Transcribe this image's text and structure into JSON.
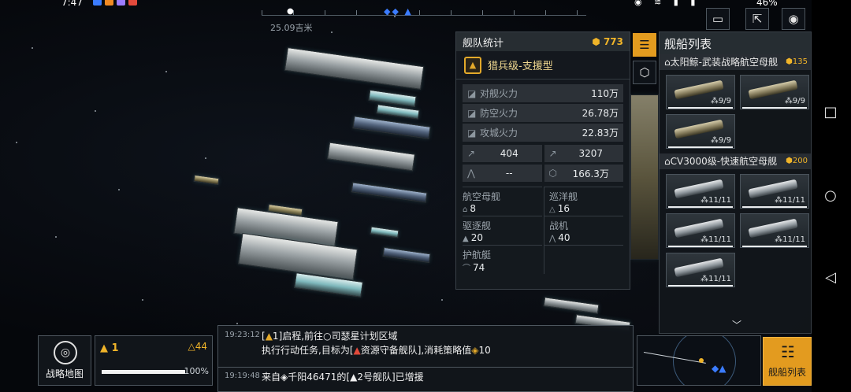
{
  "status": {
    "time": "7:47",
    "battery": "46%"
  },
  "map": {
    "distance": "25.09吉米"
  },
  "stats_panel": {
    "title": "舰队统计",
    "coins": "773",
    "fleet_class": "猎兵级-支援型",
    "firepower": [
      {
        "label": "对舰火力",
        "value": "110万"
      },
      {
        "label": "防空火力",
        "value": "26.78万"
      },
      {
        "label": "攻城火力",
        "value": "22.83万"
      }
    ],
    "mini": [
      {
        "value": "404"
      },
      {
        "value": "3207"
      },
      {
        "value": "--"
      },
      {
        "value": "166.3万"
      }
    ],
    "types": [
      {
        "label": "航空母舰",
        "count": "8"
      },
      {
        "label": "巡洋舰",
        "count": "16"
      },
      {
        "label": "驱逐舰",
        "count": "20"
      },
      {
        "label": "战机",
        "count": "40"
      },
      {
        "label": "护航艇",
        "count": "74"
      }
    ]
  },
  "ship_list": {
    "title": "舰船列表",
    "groups": [
      {
        "name": "太阳鲸-武装战略航空母舰",
        "coins": "135",
        "color": "tan",
        "ships": [
          {
            "hp": "9/9"
          },
          {
            "hp": "9/9"
          },
          {
            "hp": "9/9"
          }
        ]
      },
      {
        "name": "CV3000级-快速航空母舰",
        "coins": "200",
        "color": "grey",
        "ships": [
          {
            "hp": "11/11"
          },
          {
            "hp": "11/11"
          },
          {
            "hp": "11/11"
          },
          {
            "hp": "11/11"
          },
          {
            "hp": "11/11"
          }
        ]
      }
    ]
  },
  "bottom": {
    "strategic_map_label": "战略地图",
    "fleet_number": "1",
    "fleet_count": "44",
    "fleet_progress": 100,
    "fleet_progress_label": "100%",
    "ship_list_button": "舰船列表"
  },
  "log": [
    {
      "time": "19:23:12",
      "line1_prefix": "[",
      "line1_fleet": "1",
      "line1_suffix": "]启程,前往",
      "line1_target": "司瑟星计划区域",
      "line2_a": "执行行动任务,目标为[",
      "line2_target": "资源守备舰队",
      "line2_b": "],消耗策略值",
      "line2_cost": "10"
    },
    {
      "time": "19:19:48",
      "text_a": "来自",
      "text_place": "千阳46471的[",
      "text_fleet": "2号舰队",
      "text_b": "]已增援"
    }
  ]
}
